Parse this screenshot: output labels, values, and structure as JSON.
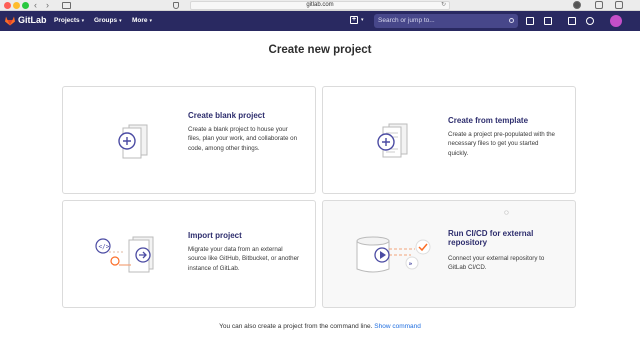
{
  "browser": {
    "url": "gitlab.com",
    "back_icon": "‹",
    "forward_icon": "›"
  },
  "nav": {
    "brand": "GitLab",
    "menus": [
      "Projects",
      "Groups",
      "More"
    ],
    "search_placeholder": "Search or jump to...",
    "colors": {
      "nav_bg": "#292961",
      "search_bg": "#47478a",
      "logo": "#fc6d26"
    }
  },
  "page": {
    "title": "Create new project"
  },
  "cards": [
    {
      "title": "Create blank project",
      "desc": "Create a blank project to house your files, plan your work, and collaborate on code, among other things."
    },
    {
      "title": "Create from template",
      "desc": "Create a project pre-populated with the necessary files to get you started quickly."
    },
    {
      "title": "Import project",
      "desc": "Migrate your data from an external source like GitHub, Bitbucket, or another instance of GitLab."
    },
    {
      "title": "Run CI/CD for external repository",
      "desc": "Connect your external repository to GitLab CI/CD."
    }
  ],
  "footer": {
    "text": "You can also create a project from the command line.",
    "link": "Show command"
  }
}
